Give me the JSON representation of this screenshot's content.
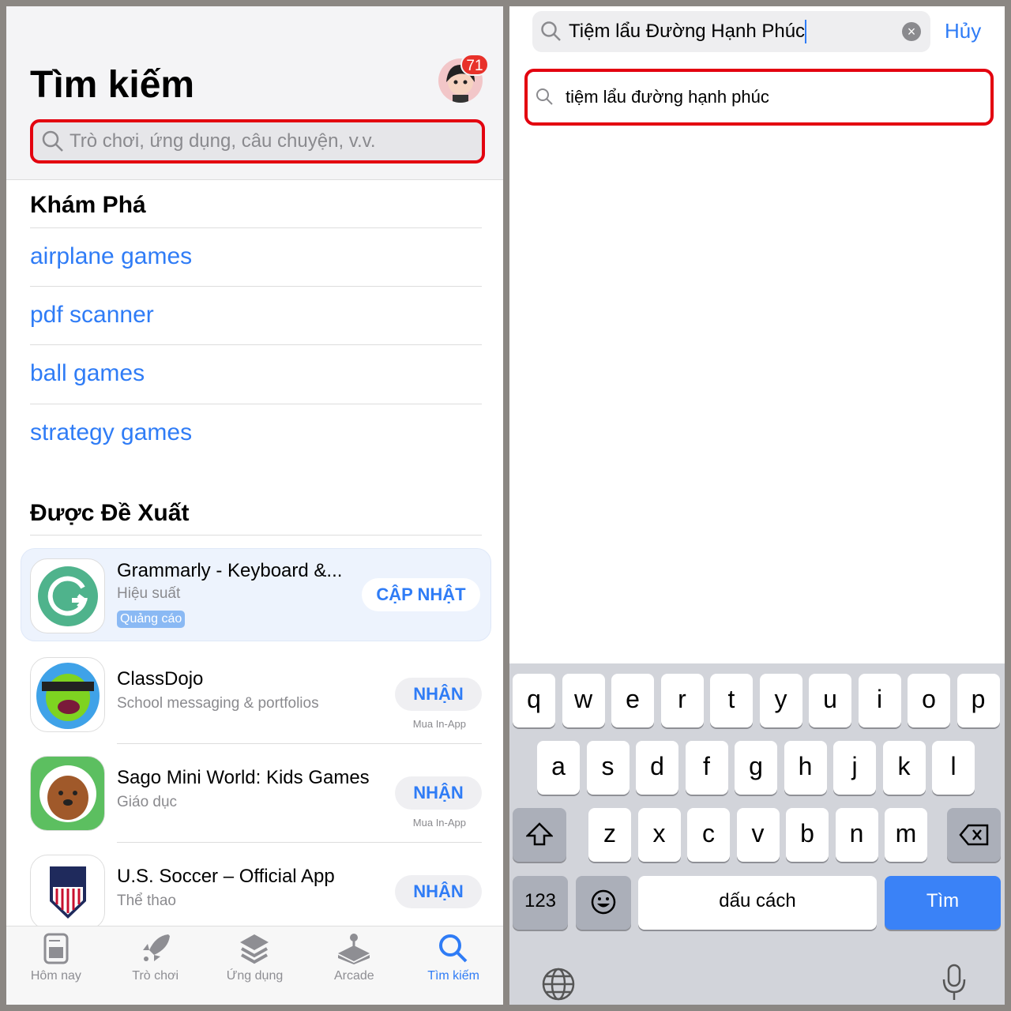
{
  "left": {
    "title": "Tìm kiếm",
    "badge_count": "71",
    "search_placeholder": "Trò chơi, ứng dụng, câu chuyện, v.v.",
    "discover_title": "Khám Phá",
    "discover_items": [
      "airplane games",
      "pdf scanner",
      "ball games",
      "strategy games"
    ],
    "suggested_title": "Được Đề Xuất",
    "apps": [
      {
        "name": "Grammarly - Keyboard &...",
        "subtitle": "Hiệu suất",
        "ad_label": "Quảng cáo",
        "button": "CẬP NHẬT",
        "icon": "grammarly-icon"
      },
      {
        "name": "ClassDojo",
        "subtitle": "School messaging & portfolios",
        "button": "NHẬN",
        "note": "Mua In-App",
        "icon": "classdojo-icon"
      },
      {
        "name": "Sago Mini World: Kids Games",
        "subtitle": "Giáo dục",
        "button": "NHẬN",
        "note": "Mua In-App",
        "icon": "sago-mini-icon"
      },
      {
        "name": "U.S. Soccer – Official App",
        "subtitle": "Thể thao",
        "button": "NHẬN",
        "icon": "us-soccer-icon"
      }
    ],
    "tabs": [
      {
        "label": "Hôm nay",
        "icon": "today-icon"
      },
      {
        "label": "Trò chơi",
        "icon": "rocket-icon"
      },
      {
        "label": "Ứng dụng",
        "icon": "layers-icon"
      },
      {
        "label": "Arcade",
        "icon": "joystick-icon"
      },
      {
        "label": "Tìm kiếm",
        "icon": "search-icon",
        "active": true
      }
    ]
  },
  "right": {
    "search_value": "Tiệm lẩu Đường Hạnh Phúc",
    "cancel": "Hủy",
    "suggestion": "tiệm lẩu đường hạnh phúc",
    "keyboard": {
      "row1": [
        "q",
        "w",
        "e",
        "r",
        "t",
        "y",
        "u",
        "i",
        "o",
        "p"
      ],
      "row2": [
        "a",
        "s",
        "d",
        "f",
        "g",
        "h",
        "j",
        "k",
        "l"
      ],
      "row3": [
        "z",
        "x",
        "c",
        "v",
        "b",
        "n",
        "m"
      ],
      "numbers": "123",
      "space": "dấu cách",
      "search": "Tìm"
    }
  },
  "colors": {
    "accent": "#2f7cf6",
    "highlight": "#e3000f",
    "search_key": "#3a82f7"
  }
}
